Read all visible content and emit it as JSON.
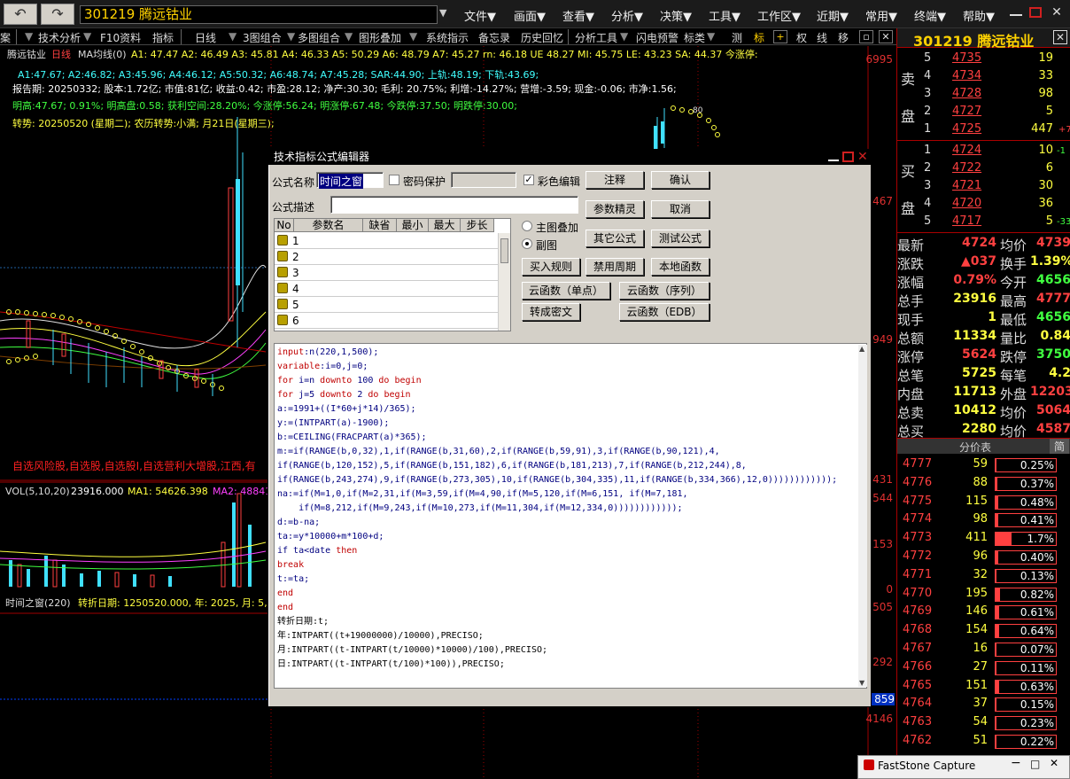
{
  "app": {
    "stock_code_name": "301219 腾远钴业",
    "menus": [
      "文件▼",
      "画面▼",
      "查看▼",
      "分析▼",
      "决策▼",
      "工具▼",
      "工作区▼",
      "近期▼",
      "常用▼",
      "终端▼",
      "帮助▼"
    ]
  },
  "toolbar": {
    "items": [
      "案",
      "技术分析",
      "F10资料",
      "指标",
      "日线",
      "3图组合",
      "多图组合",
      "图形叠加",
      "系统指示",
      "备忘录",
      "历史回忆",
      "分析工具",
      "闪电预警",
      "标类",
      "测",
      "标",
      "权",
      "线",
      "移"
    ]
  },
  "chart": {
    "title": "腾远钴业",
    "period": "日线",
    "ma_label": "MA均线(0)",
    "ma_values": "A1: 47.47  A2: 46.49  A3: 45.81  A4: 46.33  A5: 50.29  A6: 48.79  A7: 45.27  rn: 46.18  UE 48.27  MI: 45.75  LE: 43.23  SA: 44.37  今涨停:",
    "line2": "A1:47.67;  A2:46.82;  A3:45.96;  A4:46.12;  A5:50.32;  A6:48.74;  A7:45.28;  SAR:44.90;  上轨:48.19;  下轨:43.69;",
    "line3": "报告期: 20250332;   股本:1.72亿;   市值:81亿;   收益:0.42;   市盈:28.12;   净产:30.30;   毛利: 20.75%;   利增:-14.27%;   营增:-3.59;   现金:-0.06;   市净:1.56;",
    "line4": "明高:47.67;     0.91%;     明高盘:0.58;  获利空间:28.20%;       今涨停:56.24;      明涨停:67.48;      今跌停:37.50;      明跌停:30.00;",
    "line5": "转势: 20250520 (星期二);      农历转势:小满;  月21日(星期三);",
    "ad_text": "自选风险股,自选股,自选股I,自选营利大增股,江西,有",
    "vol_label": "VOL(5,10,20)",
    "vol_value": "23916.000",
    "vol_ma1": "MA1: 54626.398",
    "vol_ma2": "MA2: 48841",
    "indicator_label": "时间之窗(220)",
    "indicator_values": "转折日期: 1250520.000,  年: 2025,  月: 5,  日",
    "y_top": "6995",
    "y1": "467",
    "y2": "949",
    "y3": "431",
    "y4": "544",
    "y5": "153",
    "y6": "0",
    "y7": "505",
    "y8": "292",
    "y9": "859",
    "y10": "4146",
    "sar_label": "80"
  },
  "right_panel": {
    "title": "301219 腾远钴业",
    "sell_label_1": "卖",
    "sell_label_2": "盘",
    "buy_label_1": "买",
    "buy_label_2": "盘",
    "asks": [
      {
        "level": "5",
        "price": "4735",
        "vol": "19"
      },
      {
        "level": "4",
        "price": "4734",
        "vol": "33"
      },
      {
        "level": "3",
        "price": "4728",
        "vol": "98"
      },
      {
        "level": "2",
        "price": "4727",
        "vol": "5"
      },
      {
        "level": "1",
        "price": "4725",
        "vol": "447",
        "extra": "+7"
      }
    ],
    "bids": [
      {
        "level": "1",
        "price": "4724",
        "vol": "10",
        "extra": "-1"
      },
      {
        "level": "2",
        "price": "4722",
        "vol": "6"
      },
      {
        "level": "3",
        "price": "4721",
        "vol": "30"
      },
      {
        "level": "4",
        "price": "4720",
        "vol": "36"
      },
      {
        "level": "5",
        "price": "4717",
        "vol": "5",
        "extra": "-33"
      }
    ],
    "quotes": [
      {
        "l1": "最新",
        "v1": "4724",
        "l2": "均价",
        "v2": "4739"
      },
      {
        "l1": "涨跌",
        "v1": "▲037",
        "l2": "换手",
        "v2": "1.39%"
      },
      {
        "l1": "涨幅",
        "v1": "0.79%",
        "l2": "今开",
        "v2": "4656"
      },
      {
        "l1": "总手",
        "v1": "23916",
        "l2": "最高",
        "v2": "4777"
      },
      {
        "l1": "现手",
        "v1": "1",
        "l2": "最低",
        "v2": "4656"
      },
      {
        "l1": "总额",
        "v1": "11334",
        "l2": "量比",
        "v2": "0.84"
      },
      {
        "l1": "涨停",
        "v1": "5624",
        "l2": "跌停",
        "v2": "3750"
      },
      {
        "l1": "总笔",
        "v1": "5725",
        "l2": "每笔",
        "v2": "4.2"
      },
      {
        "l1": "内盘",
        "v1": "11713",
        "l2": "外盘",
        "v2": "12203"
      },
      {
        "l1": "总卖",
        "v1": "10412",
        "l2": "均价",
        "v2": "5064"
      },
      {
        "l1": "总买",
        "v1": "2280",
        "l2": "均价",
        "v2": "4587"
      }
    ],
    "price_table_title": "分价表",
    "price_table_tab": "简",
    "price_levels": [
      {
        "price": "4777",
        "vol": "59",
        "pct": "0.25%",
        "frac": 0.02
      },
      {
        "price": "4776",
        "vol": "88",
        "pct": "0.37%",
        "frac": 0.03
      },
      {
        "price": "4775",
        "vol": "115",
        "pct": "0.48%",
        "frac": 0.04
      },
      {
        "price": "4774",
        "vol": "98",
        "pct": "0.41%",
        "frac": 0.035
      },
      {
        "price": "4773",
        "vol": "411",
        "pct": "1.7%",
        "frac": 0.27
      },
      {
        "price": "4772",
        "vol": "96",
        "pct": "0.40%",
        "frac": 0.035
      },
      {
        "price": "4771",
        "vol": "32",
        "pct": "0.13%",
        "frac": 0.01
      },
      {
        "price": "4770",
        "vol": "195",
        "pct": "0.82%",
        "frac": 0.08
      },
      {
        "price": "4769",
        "vol": "146",
        "pct": "0.61%",
        "frac": 0.06
      },
      {
        "price": "4768",
        "vol": "154",
        "pct": "0.64%",
        "frac": 0.06
      },
      {
        "price": "4767",
        "vol": "16",
        "pct": "0.07%",
        "frac": 0.01
      },
      {
        "price": "4766",
        "vol": "27",
        "pct": "0.11%",
        "frac": 0.01
      },
      {
        "price": "4765",
        "vol": "151",
        "pct": "0.63%",
        "frac": 0.06
      },
      {
        "price": "4764",
        "vol": "37",
        "pct": "0.15%",
        "frac": 0.01
      },
      {
        "price": "4763",
        "vol": "54",
        "pct": "0.23%",
        "frac": 0.02
      },
      {
        "price": "4762",
        "vol": "51",
        "pct": "0.22%",
        "frac": 0.02
      }
    ]
  },
  "dialog": {
    "title": "技术指标公式编辑器",
    "formula_name_label": "公式名称",
    "formula_name_value": "时间之窗",
    "password_label": "密码保护",
    "color_edit_label": "彩色编辑",
    "desc_label": "公式描述",
    "buttons": {
      "annotate": "注释",
      "ok": "确认",
      "param_wizard": "参数精灵",
      "cancel": "取消",
      "other_formula": "其它公式",
      "test_formula": "测试公式",
      "import_rules": "买入规则",
      "disable_period": "禁用周期",
      "local_func": "本地函数",
      "cloud_single": "云函数（单点）",
      "cloud_seq": "云函数（序列）",
      "to_cipher": "转成密文",
      "cloud_edb": "云函数（EDB）"
    },
    "radio_main": "主图叠加",
    "radio_sub": "副图",
    "grid_headers": [
      "No",
      "参数名",
      "缺省",
      "最小",
      "最大",
      "步长"
    ],
    "grid_rows": [
      "1",
      "2",
      "3",
      "4",
      "5",
      "6"
    ],
    "code_lines": [
      "input:n(220,1,500);",
      "variable:i=0,j=0;",
      "for i=n downto 100 do begin",
      "for j=5 downto 2 do begin",
      "a:=1991+((I*60+j*14)/365);",
      "y:=(INTPART(a)-1900);",
      "b:=CEILING(FRACPART(a)*365);",
      "m:=if(RANGE(b,0,32),1,if(RANGE(b,31,60),2,if(RANGE(b,59,91),3,if(RANGE(b,90,121),4,",
      "if(RANGE(b,120,152),5,if(RANGE(b,151,182),6,if(RANGE(b,181,213),7,if(RANGE(b,212,244),8,",
      "if(RANGE(b,243,274),9,if(RANGE(b,273,305),10,if(RANGE(b,304,335),11,if(RANGE(b,334,366),12,0))))))))))));",
      "na:=if(M=1,0,if(M=2,31,if(M=3,59,if(M=4,90,if(M=5,120,if(M=6,151, if(M=7,181,",
      "    if(M=8,212,if(M=9,243,if(M=10,273,if(M=11,304,if(M=12,334,0))))))))))));",
      "d:=b-na;",
      "ta:=y*10000+m*100+d;",
      "if ta<date then",
      "break",
      "t:=ta;",
      "end",
      "end",
      "转折日期:t;",
      "年:INTPART((t+19000000)/10000),PRECISO;",
      "月:INTPART((t-INTPART(t/10000)*10000)/100),PRECISO;",
      "日:INTPART((t-INTPART(t/100)*100)),PRECISO;"
    ]
  },
  "faststone": {
    "title": "FastStone Capture"
  }
}
